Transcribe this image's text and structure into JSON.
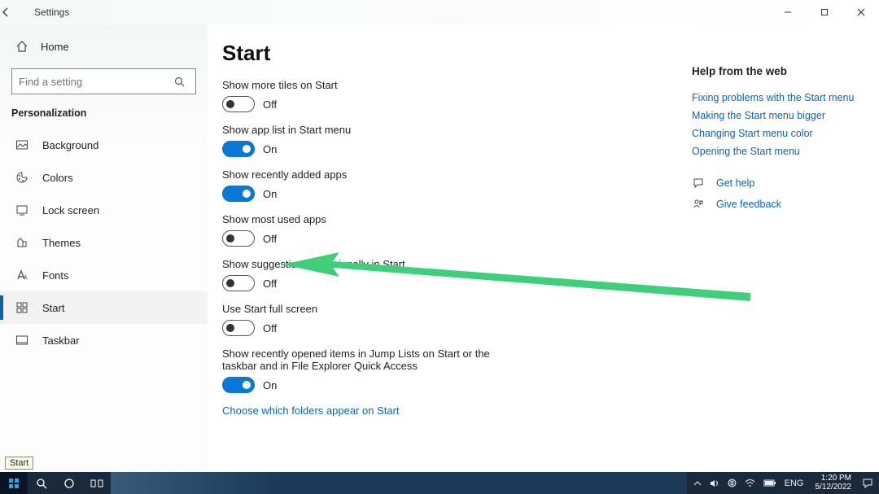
{
  "window": {
    "title": "Settings",
    "minimize": "–",
    "maximize": "❐",
    "close": "✕"
  },
  "sidebar": {
    "home": "Home",
    "search_placeholder": "Find a setting",
    "category": "Personalization",
    "items": [
      {
        "label": "Background",
        "icon": "background-icon"
      },
      {
        "label": "Colors",
        "icon": "colors-icon"
      },
      {
        "label": "Lock screen",
        "icon": "lock-screen-icon"
      },
      {
        "label": "Themes",
        "icon": "themes-icon"
      },
      {
        "label": "Fonts",
        "icon": "fonts-icon"
      },
      {
        "label": "Start",
        "icon": "start-icon"
      },
      {
        "label": "Taskbar",
        "icon": "taskbar-icon"
      }
    ]
  },
  "page": {
    "heading": "Start",
    "settings": [
      {
        "label": "Show more tiles on Start",
        "state": "Off",
        "on": false
      },
      {
        "label": "Show app list in Start menu",
        "state": "On",
        "on": true
      },
      {
        "label": "Show recently added apps",
        "state": "On",
        "on": true
      },
      {
        "label": "Show most used apps",
        "state": "Off",
        "on": false
      },
      {
        "label": "Show suggestions occasionally in Start",
        "state": "Off",
        "on": false
      },
      {
        "label": "Use Start full screen",
        "state": "Off",
        "on": false
      },
      {
        "label": "Show recently opened items in Jump Lists on Start or the taskbar and in File Explorer Quick Access",
        "state": "On",
        "on": true
      }
    ],
    "footer_link": "Choose which folders appear on Start"
  },
  "help": {
    "heading": "Help from the web",
    "links": [
      "Fixing problems with the Start menu",
      "Making the Start menu bigger",
      "Changing Start menu color",
      "Opening the Start menu"
    ],
    "get_help": "Get help",
    "give_feedback": "Give feedback"
  },
  "taskbar": {
    "tooltip": "Start",
    "lang": "ENG",
    "time": "1:20 PM",
    "date": "5/12/2022"
  }
}
